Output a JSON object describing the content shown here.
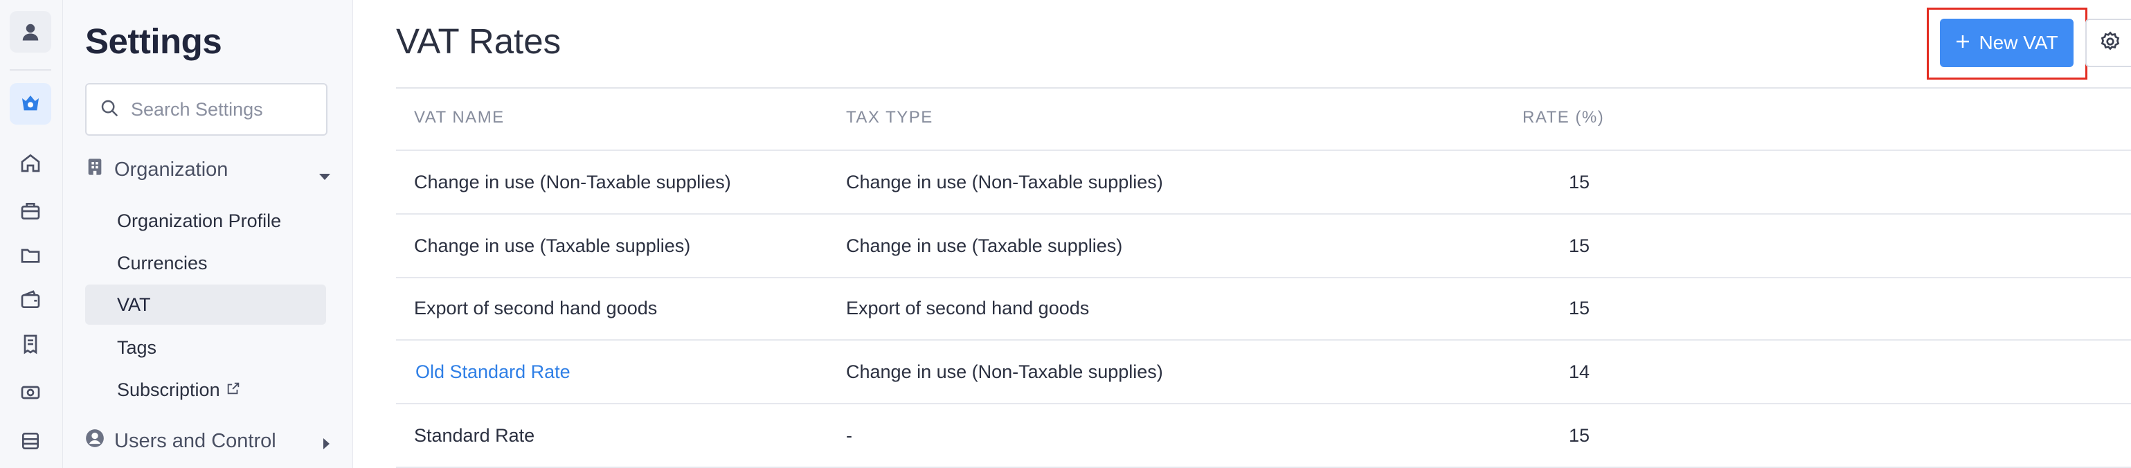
{
  "sidebar": {
    "title": "Settings",
    "search_placeholder": "Search Settings",
    "groups": [
      {
        "label": "Organization",
        "expanded": true,
        "items": [
          {
            "label": "Organization Profile"
          },
          {
            "label": "Currencies"
          },
          {
            "label": "VAT",
            "active": true
          },
          {
            "label": "Tags"
          },
          {
            "label": "Subscription",
            "external": true
          }
        ]
      },
      {
        "label": "Users and Control",
        "expanded": false
      }
    ]
  },
  "rail": {
    "icons": [
      "user-icon",
      "brand-logo-icon",
      "home-icon",
      "briefcase-icon",
      "folder-icon",
      "wallet-icon",
      "receipt-icon",
      "money-icon",
      "database-icon"
    ]
  },
  "main": {
    "title": "VAT Rates",
    "new_button_label": "New VAT",
    "columns": [
      "VAT NAME",
      "TAX TYPE",
      "RATE (%)"
    ],
    "rows": [
      {
        "name": "Change in use (Non-Taxable supplies)",
        "tax_type": "Change in use (Non-Taxable supplies)",
        "rate": "15",
        "link": false
      },
      {
        "name": "Change in use (Taxable supplies)",
        "tax_type": "Change in use (Taxable supplies)",
        "rate": "15",
        "link": false
      },
      {
        "name": "Export of second hand goods",
        "tax_type": "Export of second hand goods",
        "rate": "15",
        "link": false
      },
      {
        "name": "Old Standard Rate",
        "tax_type": "Change in use (Non-Taxable supplies)",
        "rate": "14",
        "link": true
      },
      {
        "name": "Standard Rate",
        "tax_type": "-",
        "rate": "15",
        "link": false
      }
    ]
  },
  "colors": {
    "accent": "#3f8cf4",
    "link": "#2f7fe6",
    "highlight": "#e32c21"
  }
}
